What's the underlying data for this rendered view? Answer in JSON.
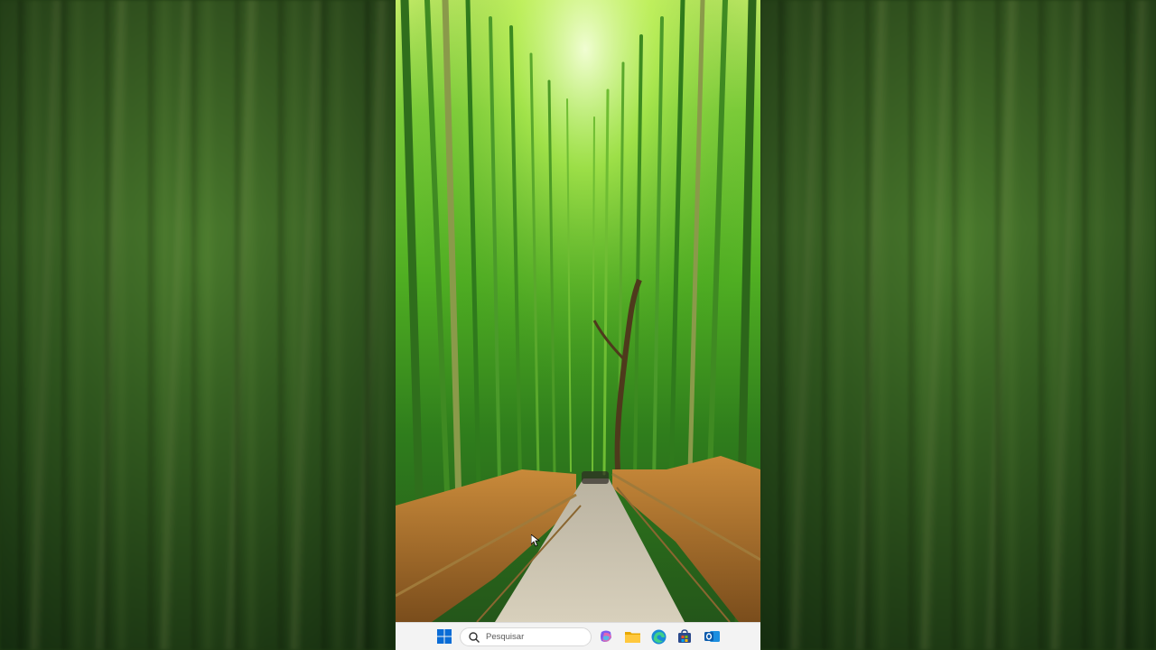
{
  "taskbar": {
    "search": {
      "placeholder": "Pesquisar"
    },
    "apps": [
      {
        "name": "start-button"
      },
      {
        "name": "copilot-icon"
      },
      {
        "name": "file-explorer-icon"
      },
      {
        "name": "edge-icon"
      },
      {
        "name": "microsoft-store-icon"
      },
      {
        "name": "outlook-icon"
      }
    ]
  },
  "colors": {
    "taskbar_bg": "#f3f3f3",
    "windows_blue": "#0a6cd6",
    "foliage": "#4fae22"
  }
}
